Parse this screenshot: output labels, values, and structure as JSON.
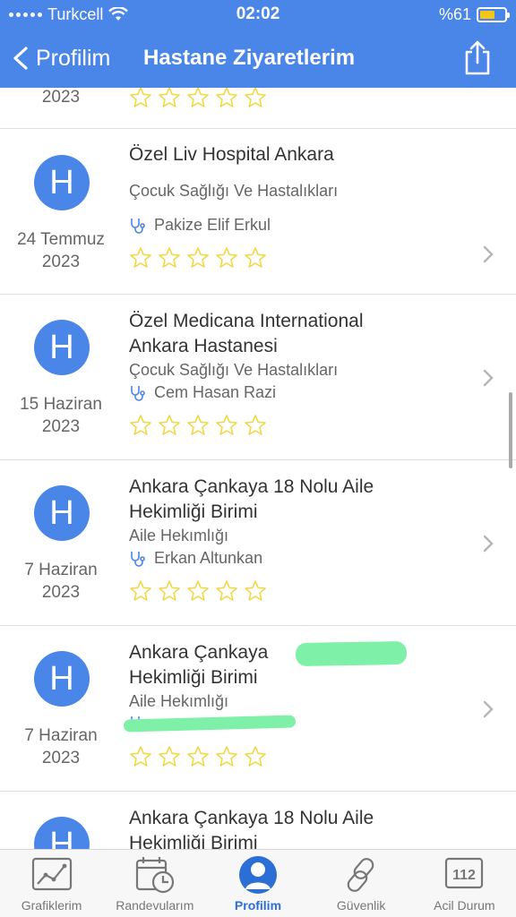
{
  "status_bar": {
    "carrier": "Turkcell",
    "time": "02:02",
    "battery": "%61",
    "battery_level": 0.61
  },
  "nav": {
    "back_label": "Profilim",
    "title": "Hastane Ziyaretlerim"
  },
  "visits": [
    {
      "date_line1": "",
      "date_line2": "2023",
      "title_line1": "",
      "title_line2": "",
      "department": "",
      "doctor": "",
      "stars": 0
    },
    {
      "date_line1": "24 Temmuz",
      "date_line2": "2023",
      "title_line1": "Özel Liv Hospital Ankara",
      "title_line2": "",
      "department": "Çocuk Sağlığı Ve Hastalıkları",
      "doctor": "Pakize Elif Erkul",
      "stars": 0
    },
    {
      "date_line1": "15 Haziran",
      "date_line2": "2023",
      "title_line1": "Özel Medicana International",
      "title_line2": "Ankara Hastanesi",
      "department": "Çocuk Sağlığı Ve Hastalıkları",
      "doctor": "Cem Hasan Razi",
      "stars": 0
    },
    {
      "date_line1": "7 Haziran",
      "date_line2": "2023",
      "title_line1": "Ankara Çankaya 18 Nolu Aile",
      "title_line2": "Hekimliği Birimi",
      "department": "Aile Hekımlığı",
      "doctor": "Erkan Altunkan",
      "stars": 0
    },
    {
      "date_line1": "7 Haziran",
      "date_line2": "2023",
      "title_line1": "Ankara Çankaya",
      "title_line2": "Hekimliği Birimi",
      "department": "Aile Hekımlığı",
      "doctor": "",
      "stars": 0
    },
    {
      "date_line1": "",
      "date_line2": "",
      "title_line1": "Ankara Çankaya 18 Nolu Aile",
      "title_line2": "Hekimliği Birimi",
      "department": "",
      "doctor": "",
      "stars": 0
    }
  ],
  "avatar_letter": "H",
  "tabs": [
    {
      "label": "Grafiklerim",
      "icon": "chart-icon",
      "active": false
    },
    {
      "label": "Randevularım",
      "icon": "calendar-clock-icon",
      "active": false
    },
    {
      "label": "Profilim",
      "icon": "profile-icon",
      "active": true
    },
    {
      "label": "Güvenlik",
      "icon": "link-icon",
      "active": false
    },
    {
      "label": "Acil Durum",
      "icon": "emergency-112-icon",
      "active": false
    }
  ],
  "emergency_number": "112",
  "colors": {
    "header": "#4a86e8",
    "accent": "#2b6fd6",
    "star": "#f0d84a",
    "redaction": "#7ff0a8"
  }
}
